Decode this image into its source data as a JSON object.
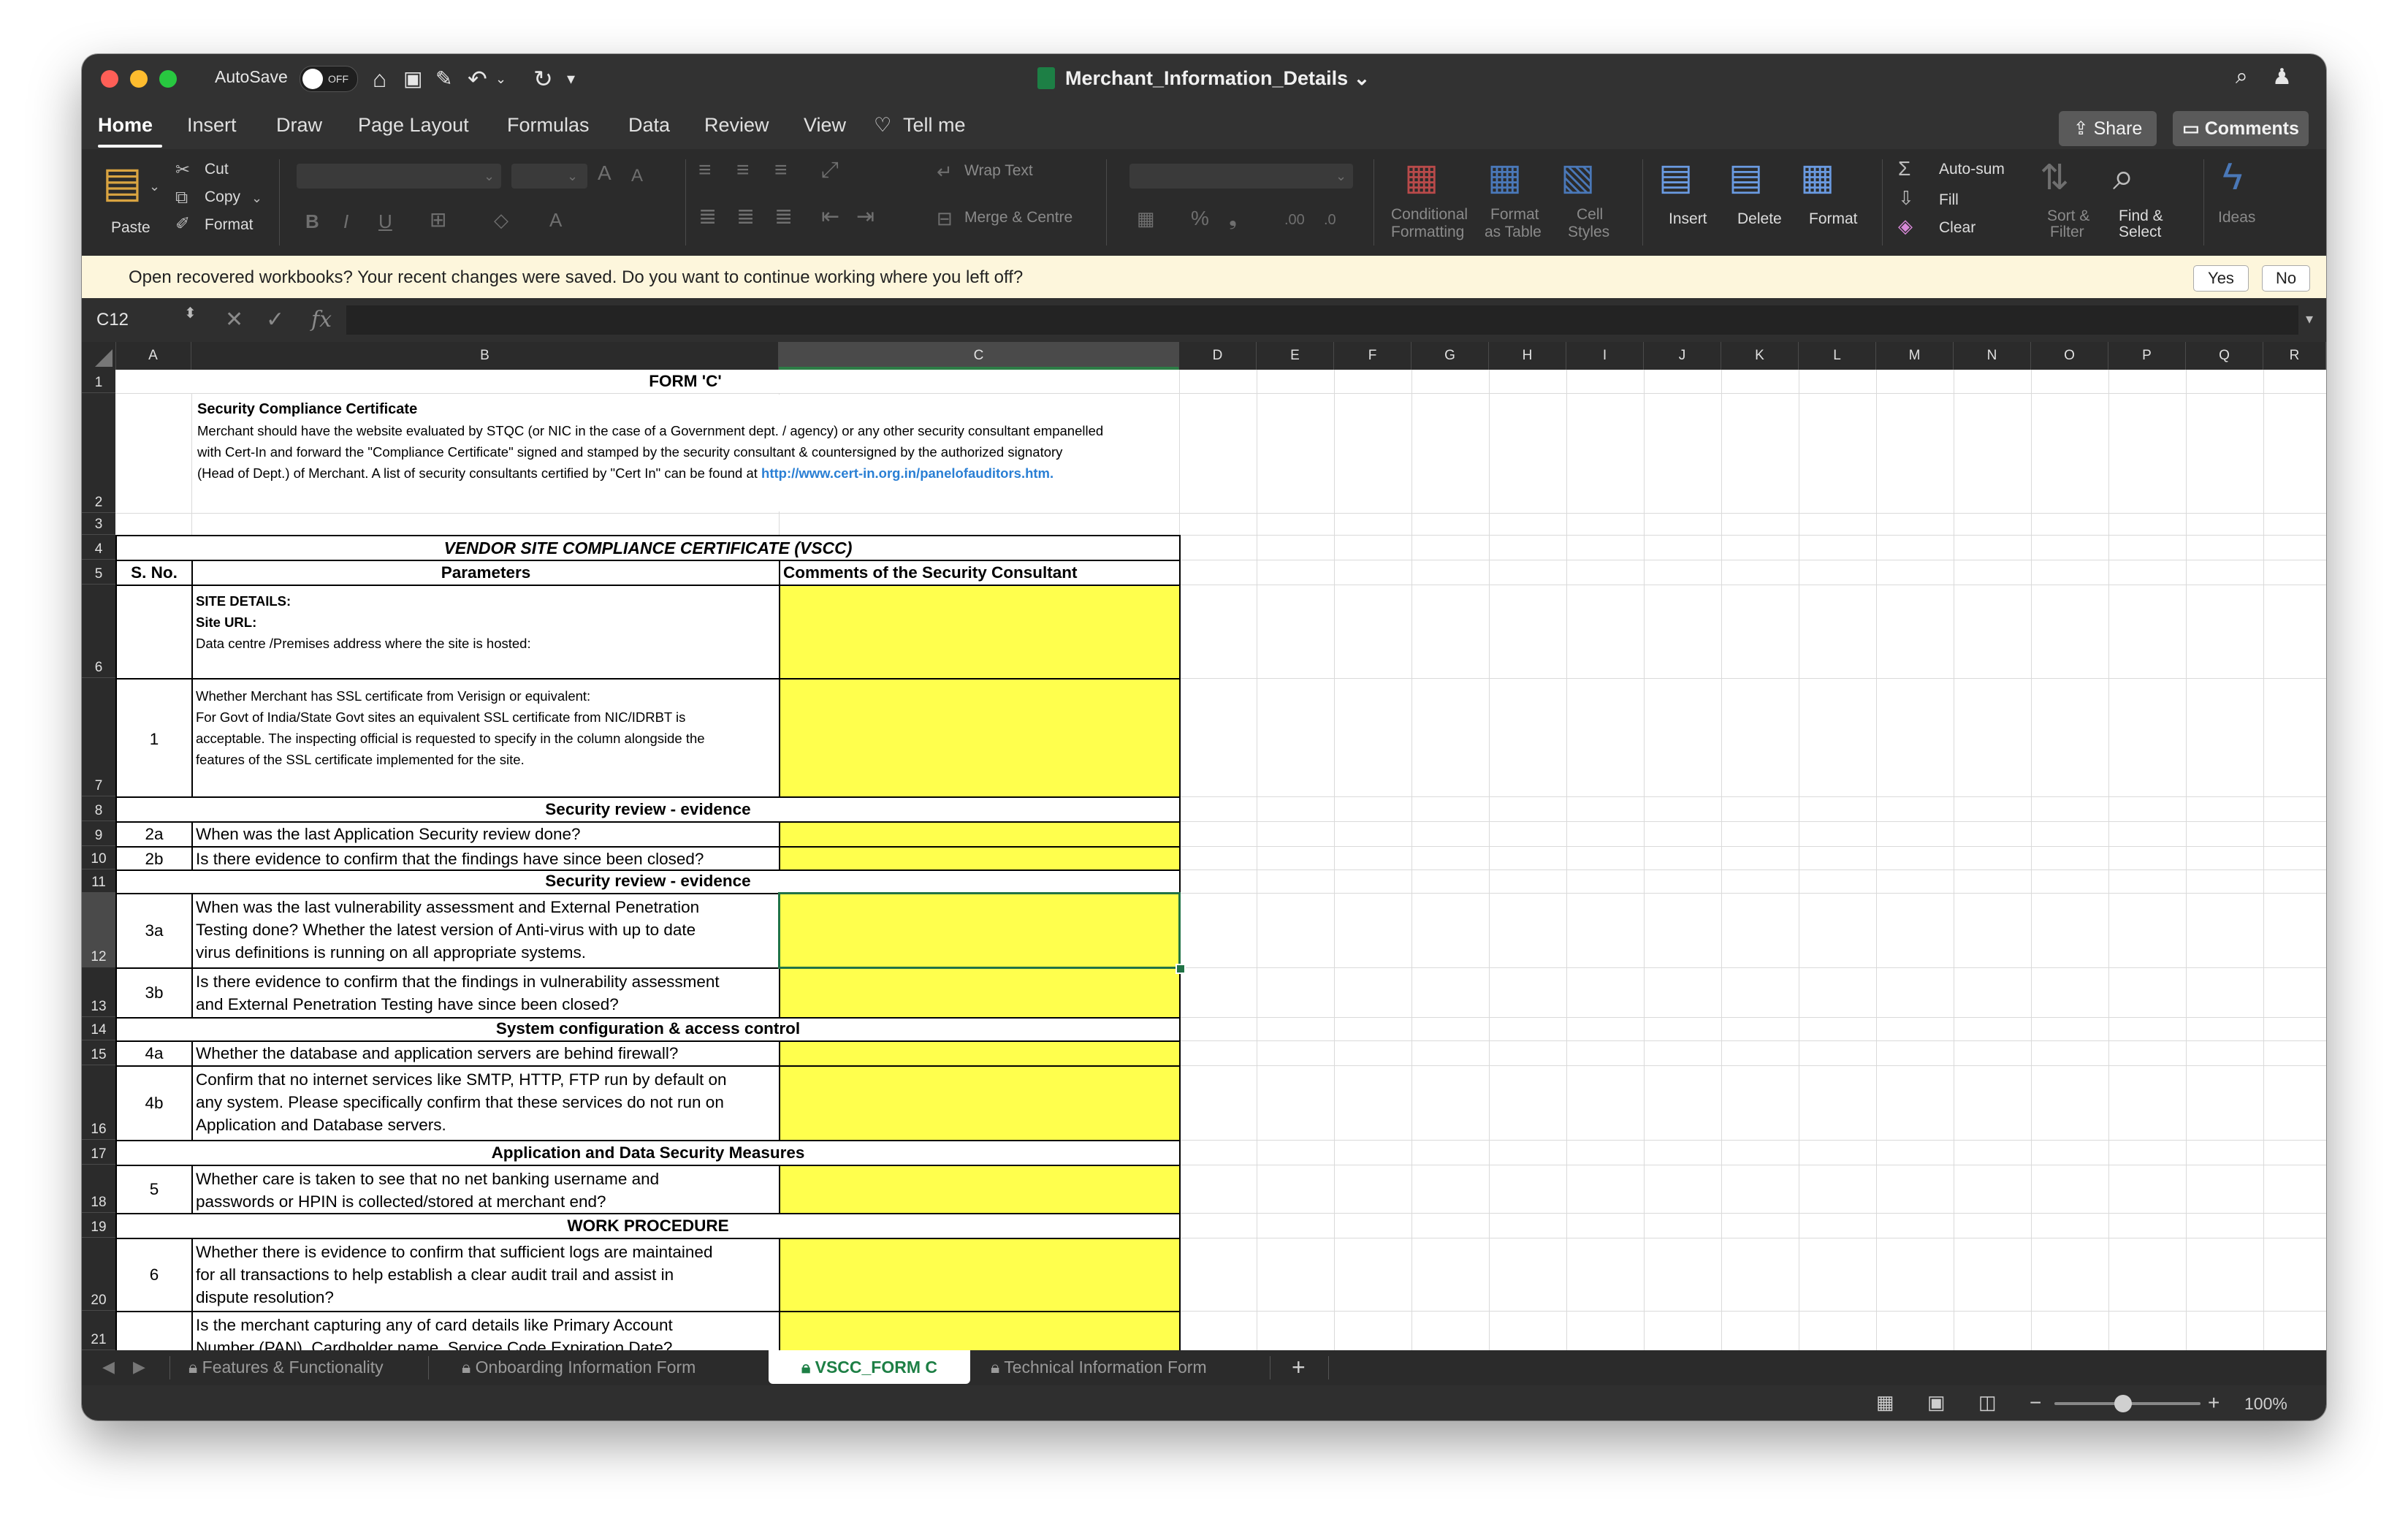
{
  "titlebar": {
    "autosave_label": "AutoSave",
    "autosave_state": "OFF",
    "doc_title": "Merchant_Information_Details ⌄"
  },
  "ribbon_tabs": [
    "Home",
    "Insert",
    "Draw",
    "Page Layout",
    "Formulas",
    "Data",
    "Review",
    "View",
    "Tell me"
  ],
  "share_label": "Share",
  "comments_label": "Comments",
  "ribbon": {
    "paste": "Paste",
    "cut": "Cut",
    "copy": "Copy",
    "format_painter": "Format",
    "wrap_text": "Wrap Text",
    "merge_centre": "Merge & Centre",
    "conditional_1": "Conditional",
    "conditional_2": "Formatting",
    "format_table_1": "Format",
    "format_table_2": "as Table",
    "cell_styles_1": "Cell",
    "cell_styles_2": "Styles",
    "insert": "Insert",
    "delete": "Delete",
    "format": "Format",
    "autosum": "Auto-sum",
    "fill": "Fill",
    "clear": "Clear",
    "sort_1": "Sort &",
    "sort_2": "Filter",
    "find_1": "Find &",
    "find_2": "Select",
    "ideas": "Ideas"
  },
  "notification": {
    "message": "Open recovered workbooks?   Your recent changes were saved. Do you want to continue working where you left off?",
    "yes": "Yes",
    "no": "No"
  },
  "formula_bar": {
    "cell_ref": "C12",
    "fx": "fx",
    "content": ""
  },
  "columns": [
    "A",
    "B",
    "C",
    "D",
    "E",
    "F",
    "G",
    "H",
    "I",
    "J",
    "K",
    "L",
    "M",
    "N",
    "O",
    "P",
    "Q",
    "R"
  ],
  "rows": [
    "1",
    "2",
    "3",
    "4",
    "5",
    "6",
    "7",
    "8",
    "9",
    "10",
    "11",
    "12",
    "13",
    "14",
    "15",
    "16",
    "17",
    "18",
    "19",
    "20",
    "21"
  ],
  "sheet": {
    "form_title": "FORM 'C'",
    "cert_heading": "Security Compliance Certificate",
    "cert_line1": "Merchant  should  have the website evaluated by STQC (or NIC in the case of a Government dept. / agency) or any other security consultant empanelled",
    "cert_line2": "with Cert-In and forward the \"Compliance Certificate\" signed and stamped by the security consultant & countersigned by the authorized signatory",
    "cert_line3": "(Head of Dept.) of Merchant. A list of security consultants certified by \"Cert In\" can be found at",
    "cert_link": "http://www.cert-in.org.in/panelofauditors.htm.",
    "vscc_title": "VENDOR SITE COMPLIANCE CERTIFICATE (VSCC)",
    "hdr_sno": "S. No.",
    "hdr_params": "Parameters",
    "hdr_comments": "Comments of the Security Consultant",
    "r6_l1": "SITE DETAILS:",
    "r6_l2": "Site URL:",
    "r6_l3": "Data centre /Premises address where the site is hosted:",
    "r7_sno": "1",
    "r7_l1": "Whether Merchant has SSL certificate from Verisign or equivalent:",
    "r7_l2": "For Govt of India/State Govt sites an equivalent SSL certificate from NIC/IDRBT is",
    "r7_l3": "acceptable. The inspecting official is requested to specify in the column alongside the",
    "r7_l4": "features of the SSL certificate implemented for the site.",
    "sec_review_1": "Security review - evidence",
    "r9_sno": "2a",
    "r9_text": "When was the last Application Security review done?",
    "r10_sno": "2b",
    "r10_text": "Is there evidence to confirm that the findings have since been closed?",
    "sec_review_2": "Security review - evidence",
    "r12_sno": "3a",
    "r12_l1": "When was the last vulnerability assessment and External Penetration",
    "r12_l2": "Testing done? Whether the latest version of Anti-virus with up to date",
    "r12_l3": "virus definitions is running on all appropriate systems.",
    "r13_sno": "3b",
    "r13_l1": "Is there evidence to confirm that the findings in vulnerability assessment",
    "r13_l2": "and External Penetration Testing have since been closed?",
    "sys_config": "System configuration & access control",
    "r15_sno": "4a",
    "r15_text": "Whether the database and application servers are behind firewall?",
    "r16_sno": "4b",
    "r16_l1": "Confirm that no internet services like SMTP, HTTP, FTP run by default on",
    "r16_l2": "any system. Please specifically confirm that these services do not run on",
    "r16_l3": "Application and Database servers.",
    "app_data": "Application and Data Security Measures",
    "r18_sno": "5",
    "r18_l1": "Whether care is taken to see that no net banking username and",
    "r18_l2": "passwords or HPIN is collected/stored at merchant end?",
    "work_proc": "WORK PROCEDURE",
    "r20_sno": "6",
    "r20_l1": "Whether there is evidence to confirm that sufficient logs are maintained",
    "r20_l2": "for all transactions to help establish a clear audit trail and assist in",
    "r20_l3": "dispute resolution?",
    "r21_l1": "Is the merchant capturing any of card details like Primary Account",
    "r21_l2": "Number (PAN),   Cardholder name, Service Code Expiration Date?"
  },
  "sheet_tabs": [
    "Features & Functionality",
    "Onboarding Information Form",
    "VSCC_FORM C",
    "Technical Information Form"
  ],
  "status": {
    "zoom": "100%"
  }
}
